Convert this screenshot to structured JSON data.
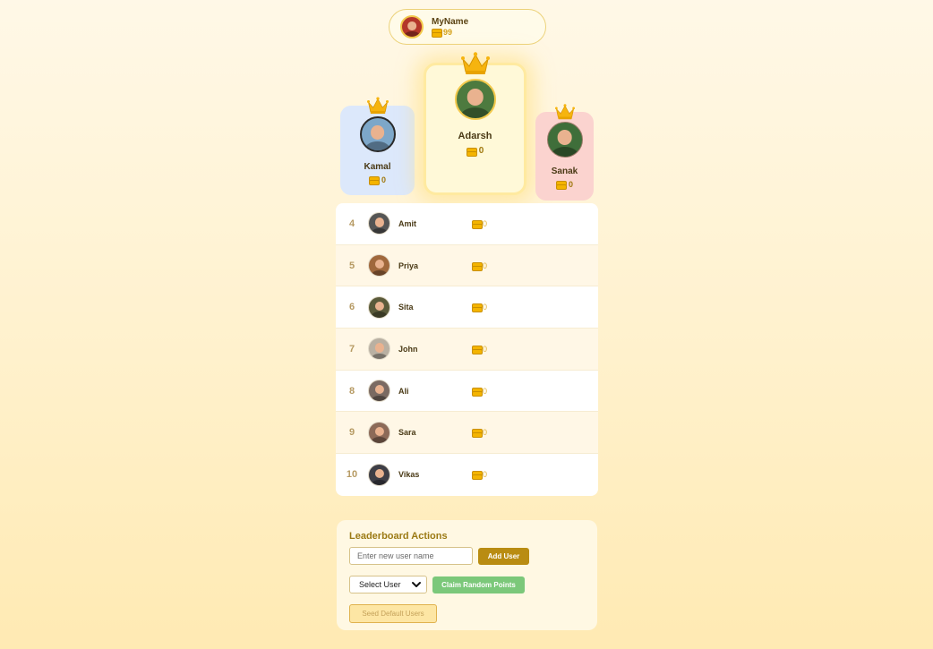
{
  "colors": {
    "accent": "#b98c12",
    "coin": "#f4b400",
    "podium_first": "#fff9d8",
    "podium_second": "#dce8fb",
    "podium_third": "#fbd3cf",
    "claim_button": "#7bc87a"
  },
  "icons": {
    "coin": "coin-stack-icon",
    "crown": "crown-icon",
    "chevron": "chevron-down-icon"
  },
  "profile": {
    "name": "MyName",
    "points": "99"
  },
  "podium": {
    "first": {
      "name": "Adarsh",
      "points": "0"
    },
    "second": {
      "name": "Kamal",
      "points": "0"
    },
    "third": {
      "name": "Sanak",
      "points": "0"
    }
  },
  "rankings": [
    {
      "rank": "4",
      "name": "Amit",
      "points": "0"
    },
    {
      "rank": "5",
      "name": "Priya",
      "points": "0"
    },
    {
      "rank": "6",
      "name": "Sita",
      "points": "0"
    },
    {
      "rank": "7",
      "name": "John",
      "points": "0"
    },
    {
      "rank": "8",
      "name": "Ali",
      "points": "0"
    },
    {
      "rank": "9",
      "name": "Sara",
      "points": "0"
    },
    {
      "rank": "10",
      "name": "Vikas",
      "points": "0"
    }
  ],
  "actions": {
    "title": "Leaderboard Actions",
    "new_user_placeholder": "Enter new user name",
    "add_user_label": "Add User",
    "select_user_value": "Select User",
    "claim_label": "Claim Random Points",
    "seed_label": "Seed Default Users"
  }
}
